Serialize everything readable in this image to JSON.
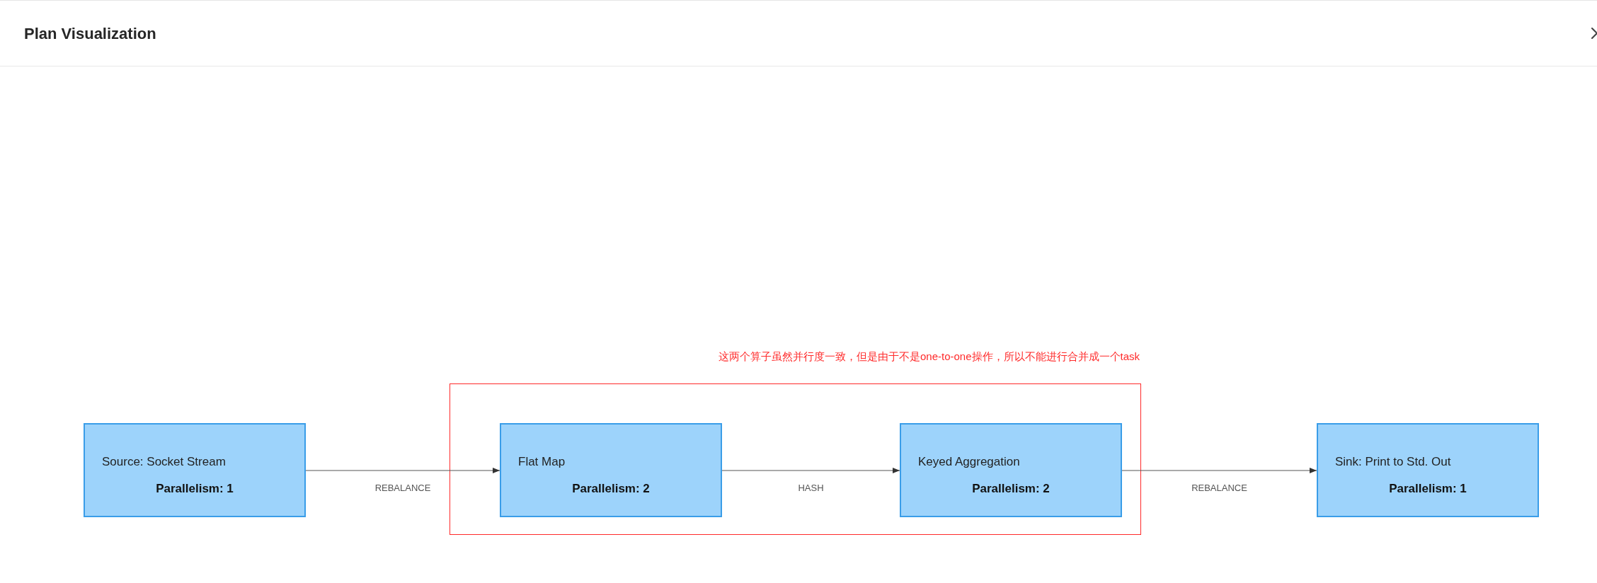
{
  "window": {
    "title": "Plan Visualization"
  },
  "plan": [
    {
      "kind": "node",
      "name": "Source: Socket Stream",
      "parallelism": "Parallelism: 1"
    },
    {
      "kind": "group",
      "note": "这两个算子虽然并行度一致，但是由于不是one-to-one操作，所以不能进行合并成一个task",
      "color": "#ff2a2a",
      "children": [
        {
          "kind": "node",
          "name": "Flat Map",
          "parallelism": "Parallelism: 2"
        },
        {
          "kind": "node",
          "name": "Keyed Aggregation",
          "parallelism": "Parallelism: 2"
        }
      ]
    },
    {
      "kind": "node",
      "name": "Sink: Print to Std. Out",
      "parallelism": "Parallelism: 1"
    }
  ],
  "edges": [
    {
      "label": "REBALANCE"
    },
    {
      "label": "HASH"
    },
    {
      "label": "REBALANCE"
    }
  ]
}
